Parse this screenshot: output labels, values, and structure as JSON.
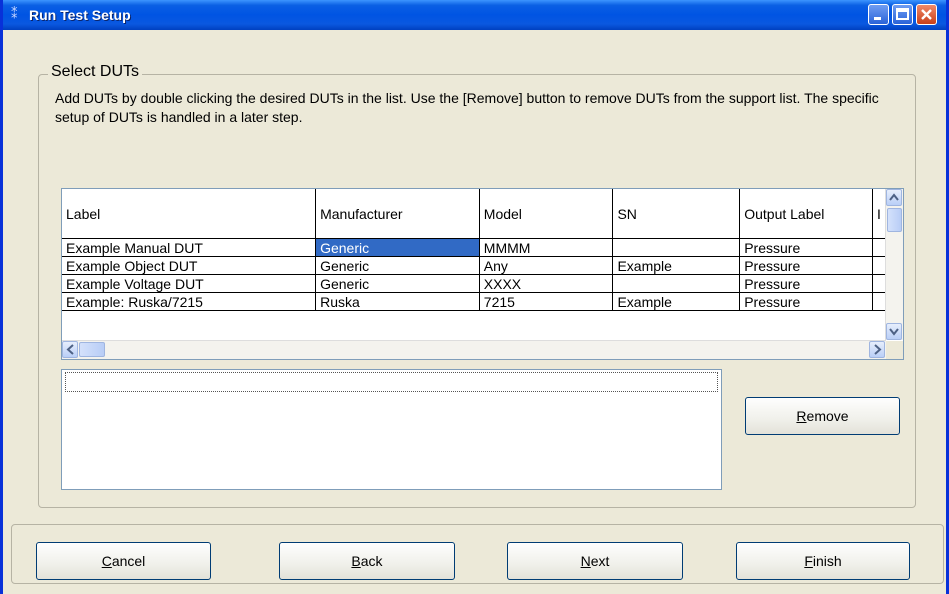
{
  "window": {
    "title": "Run Test Setup"
  },
  "group": {
    "title": "Select DUTs"
  },
  "instructions": "Add DUTs by double clicking the desired DUTs in the list.  Use the [Remove] button to remove DUTs from the support list.  The specific setup of DUTs is handled in a later step.",
  "grid": {
    "columns": [
      "Label",
      "Manufacturer",
      "Model",
      "SN",
      "Output Label",
      "I"
    ],
    "rows": [
      [
        "Example Manual DUT",
        "Generic",
        "MMMM",
        "",
        "Pressure"
      ],
      [
        "Example Object DUT",
        "Generic",
        "Any",
        "Example",
        "Pressure"
      ],
      [
        "Example Voltage DUT",
        "Generic",
        "XXXX",
        "",
        "Pressure"
      ],
      [
        "Example: Ruska/7215",
        "Ruska",
        "7215",
        "Example",
        "Pressure"
      ]
    ],
    "selected_cell": "Generic"
  },
  "buttons": {
    "remove": {
      "key": "R",
      "rest": "emove"
    },
    "cancel": {
      "key": "C",
      "rest": "ancel"
    },
    "back": {
      "key": "B",
      "rest": "ack"
    },
    "next": {
      "key": "N",
      "rest": "ext"
    },
    "finish": {
      "key": "F",
      "rest": "inish"
    }
  },
  "colors": {
    "titlebar": "#0054e3",
    "selection": "#316ac5",
    "window_bg": "#ece9d8"
  }
}
